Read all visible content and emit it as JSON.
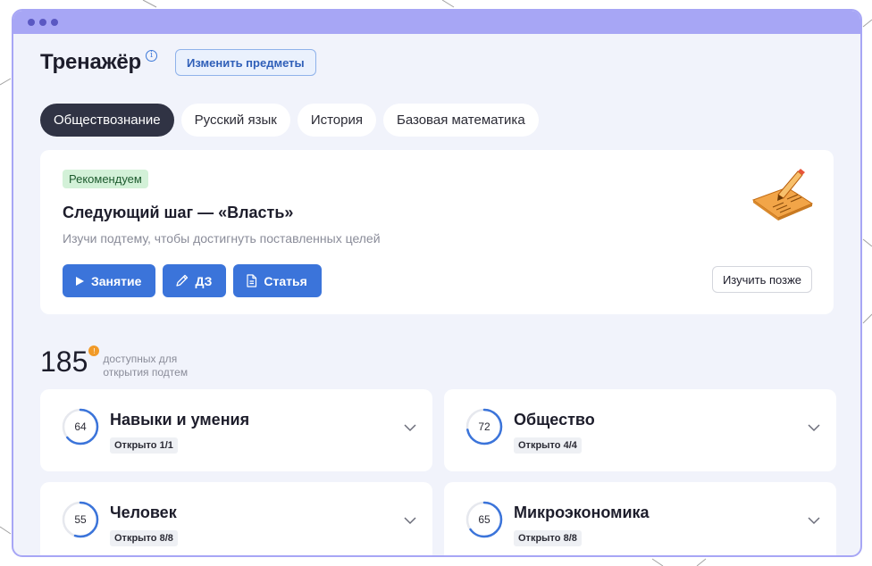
{
  "header": {
    "title": "Тренажёр",
    "change_subjects": "Изменить предметы"
  },
  "tabs": [
    {
      "label": "Обществознание",
      "active": true
    },
    {
      "label": "Русский язык",
      "active": false
    },
    {
      "label": "История",
      "active": false
    },
    {
      "label": "Базовая математика",
      "active": false
    }
  ],
  "recommendation": {
    "badge": "Рекомендуем",
    "title": "Следующий шаг — «Власть»",
    "subtitle": "Изучи подтему, чтобы достигнуть поставленных целей",
    "actions": {
      "lesson": "Занятие",
      "homework": "ДЗ",
      "article": "Статья"
    },
    "later": "Изучить позже"
  },
  "stats": {
    "count": "185",
    "alert": "!",
    "label": "доступных для открытия подтем"
  },
  "topics": [
    {
      "score": "64",
      "title": "Навыки и умения",
      "status": "Открыто 1/1",
      "progress": 0.64
    },
    {
      "score": "72",
      "title": "Общество",
      "status": "Открыто 4/4",
      "progress": 0.72
    },
    {
      "score": "55",
      "title": "Человек",
      "status": "Открыто 8/8",
      "progress": 0.55
    },
    {
      "score": "65",
      "title": "Микроэкономика",
      "status": "Открыто 8/8",
      "progress": 0.65
    }
  ],
  "colors": {
    "accent": "#3b74da",
    "frame": "#a7a6f5",
    "active_tab": "#303344",
    "badge_bg": "#d3f1d8",
    "alert": "#f19a28"
  },
  "icons": {
    "info": "info-icon",
    "play": "play-icon",
    "pencil": "pencil-icon",
    "document": "document-icon",
    "chevron": "chevron-down-icon"
  }
}
